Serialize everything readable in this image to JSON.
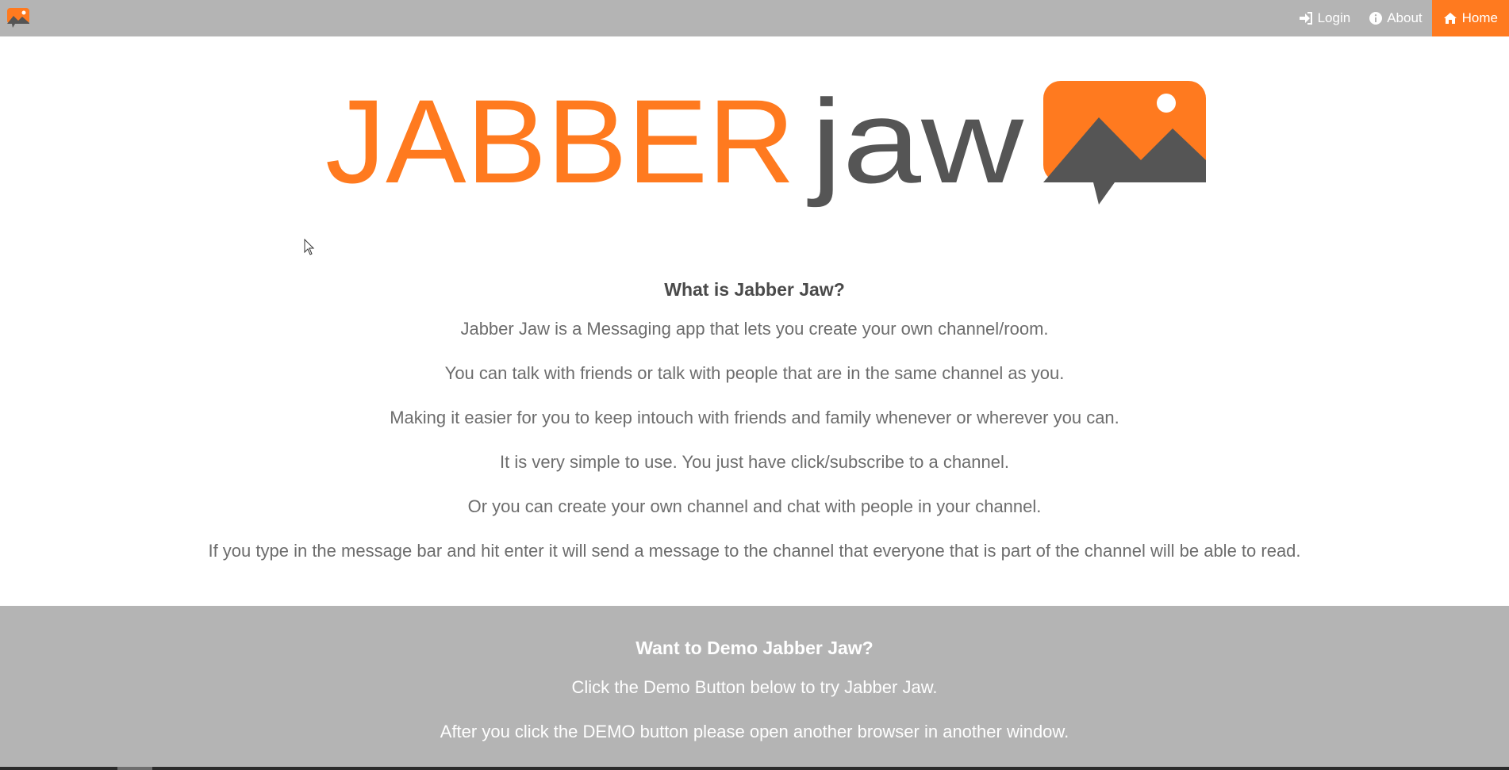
{
  "navbar": {
    "logo_icon": "jabberjaw-logo-icon",
    "items": [
      {
        "label": "Login",
        "icon": "sign-in-icon"
      },
      {
        "label": "About",
        "icon": "info-icon"
      },
      {
        "label": "Home",
        "icon": "home-icon",
        "active": true
      }
    ]
  },
  "hero": {
    "brand_part1": "JABBER",
    "brand_part2": "jaw",
    "colors": {
      "orange": "#ff7a1f",
      "gray": "#555555"
    }
  },
  "about": {
    "heading": "What is Jabber Jaw?",
    "paragraphs": [
      "Jabber Jaw is a Messaging app that lets you create your own channel/room.",
      "You can talk with friends or talk with people that are in the same channel as you.",
      "Making it easier for you to keep intouch with friends and family whenever or wherever you can.",
      "It is very simple to use. You just have click/subscribe to a channel.",
      "Or you can create your own channel and chat with people in your channel.",
      "If you type in the message bar and hit enter it will send a message to the channel that everyone that is part of the channel will be able to read."
    ]
  },
  "demo": {
    "heading": "Want to Demo Jabber Jaw?",
    "paragraphs": [
      "Click the Demo Button below to try Jabber Jaw.",
      "After you click the DEMO button please open another browser in another window."
    ]
  },
  "colors": {
    "navbar_bg": "#b4b4b4",
    "accent": "#ff7a1f",
    "text": "#6d6d6d"
  }
}
